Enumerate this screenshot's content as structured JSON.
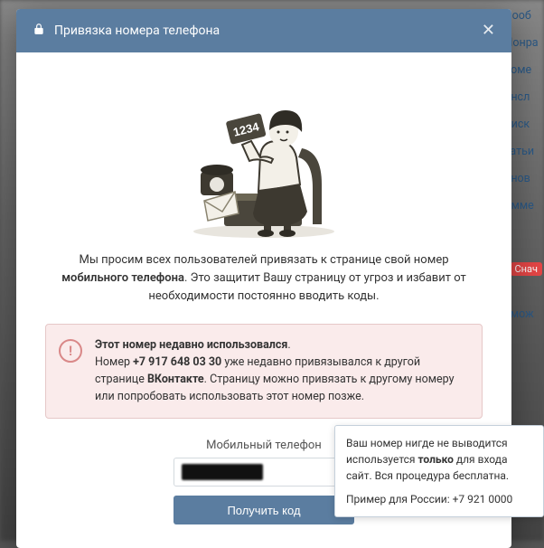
{
  "bg_links": [
    "Сооб",
    "Понра",
    "коме",
    "ансл",
    "оиск",
    "татьи",
    "бнов",
    "омме"
  ],
  "bg_badge_label": "Снач",
  "bg_badge_other": "змож",
  "header": {
    "title": "Привязка номера телефона"
  },
  "illustration": {
    "card_number": "1234"
  },
  "intro": {
    "prefix": "Мы просим всех пользователей привязать к странице свой номер ",
    "bold": "мобильного телефона",
    "suffix": ". Это защитит Вашу страницу от угроз и избавит от необходимости постоянно вводить коды."
  },
  "warning": {
    "title": "Этот номер недавно использовался",
    "line_prefix": "Номер ",
    "phone": "+7 917 648 03 30",
    "line_mid": " уже недавно привязывался к другой странице ",
    "brand": "ВКонтакте",
    "line_end": ". Страницу можно привязать к другому номеру или попробовать использовать этот номер позже."
  },
  "form": {
    "label": "Мобильный телефон",
    "button": "Получить код"
  },
  "tooltip": {
    "p1_prefix": "Ваш номер нигде не выводится",
    "p1_mid": " используется ",
    "p1_bold": "только",
    "p1_suffix": " для входа сайт. Вся процедура бесплатна.",
    "p2": "Пример для России: +7 921 0000"
  }
}
